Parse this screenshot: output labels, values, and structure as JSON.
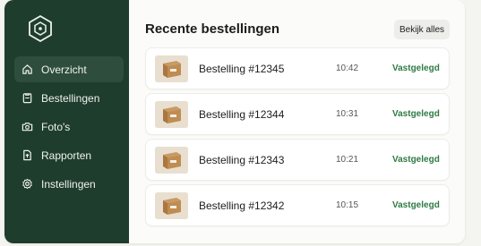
{
  "sidebar": {
    "logo_icon": "hexagon-logo-icon",
    "items": [
      {
        "label": "Overzicht",
        "icon": "home-icon",
        "active": true
      },
      {
        "label": "Bestellingen",
        "icon": "clipboard-icon",
        "active": false
      },
      {
        "label": "Foto's",
        "icon": "camera-icon",
        "active": false
      },
      {
        "label": "Rapporten",
        "icon": "document-upload-icon",
        "active": false
      },
      {
        "label": "Instellingen",
        "icon": "gear-icon",
        "active": false
      }
    ]
  },
  "main": {
    "title": "Recente bestellingen",
    "view_all_label": "Bekijk alles",
    "orders": [
      {
        "name": "Bestelling #12345",
        "time": "10:42",
        "status": "Vastgelegd"
      },
      {
        "name": "Bestelling #12344",
        "time": "10:31",
        "status": "Vastgelegd"
      },
      {
        "name": "Bestelling #12343",
        "time": "10:21",
        "status": "Vastgelegd"
      },
      {
        "name": "Bestelling #12342",
        "time": "10:15",
        "status": "Vastgelegd"
      }
    ]
  },
  "colors": {
    "sidebar_bg": "#1f3d2c",
    "sidebar_active": "#2f4d3c",
    "status_green": "#2f7a44"
  }
}
